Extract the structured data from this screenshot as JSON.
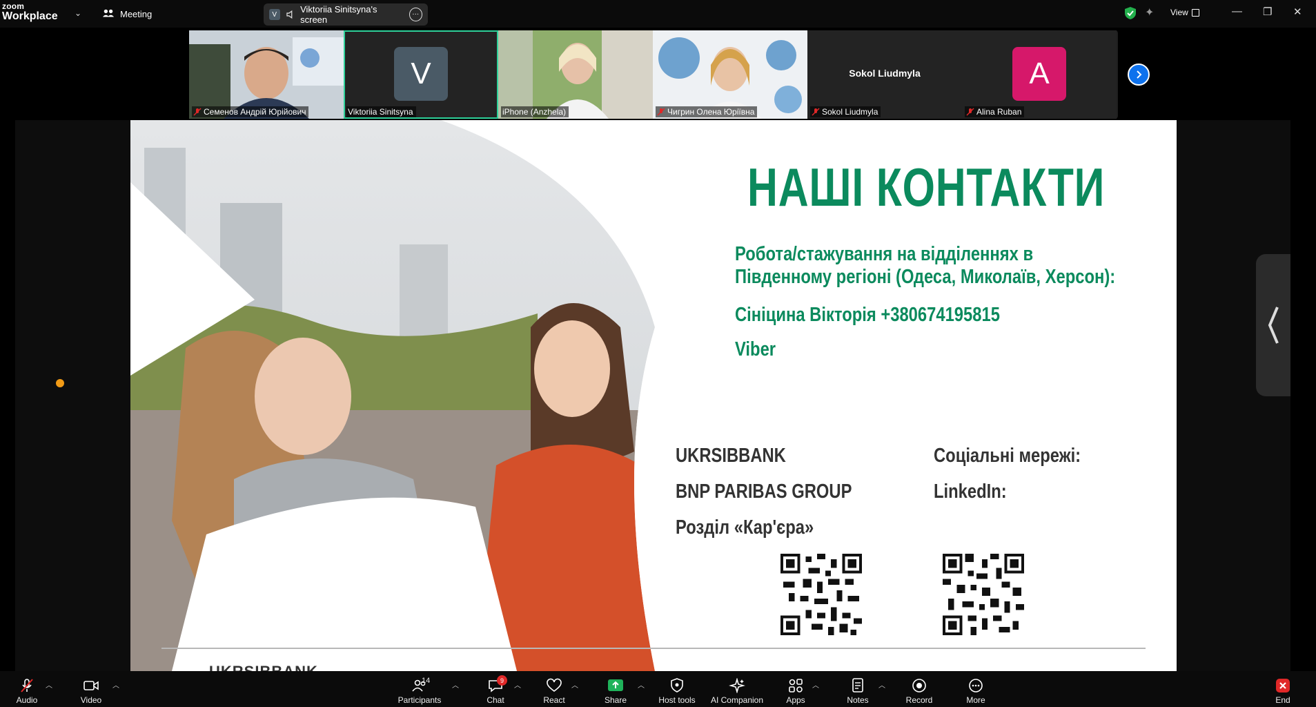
{
  "app": {
    "brand_line1": "zoom",
    "brand_line2": "Workplace",
    "meeting_label": "Meeting"
  },
  "share": {
    "badge": "V",
    "label": "Viktoriia Sinitsyna's screen"
  },
  "topbar": {
    "view_label": "View"
  },
  "participants": [
    {
      "name": "Семенов Андрій Юрійович",
      "muted": true,
      "type": "video"
    },
    {
      "name": "Viktoriia Sinitsyna",
      "muted": false,
      "type": "avatar",
      "initial": "V",
      "color": "#4a5a66",
      "active": true
    },
    {
      "name": "iPhone (Anzhela)",
      "muted": false,
      "type": "video"
    },
    {
      "name": "Чигрин Олена Юріївна",
      "muted": true,
      "type": "video"
    },
    {
      "name": "Sokol Liudmyla",
      "muted": true,
      "type": "name",
      "display": "Sokol Liudmyla"
    },
    {
      "name": "Alina Ruban",
      "muted": true,
      "type": "avatar",
      "initial": "A",
      "color": "#d6186a"
    }
  ],
  "slide": {
    "title": "НАШІ КОНТАКТИ",
    "line1": "Робота/стажування на відділеннях в",
    "line2": "Південному регіоні (Одеса, Миколаїв, Херсон):",
    "contact": "Сініцина Вікторія +380674195815",
    "viber": "Viber",
    "bank1": "UKRSIBBANK",
    "bank2": "BNP PARIBAS GROUP",
    "career": "Розділ «Кар'єра»",
    "social": "Соціальні мережі:",
    "linkedin": "LinkedIn:",
    "footer": "UKRSIBBANK"
  },
  "toolbar": {
    "audio": "Audio",
    "video": "Video",
    "participants": "Participants",
    "participants_count": "14",
    "chat": "Chat",
    "chat_badge": "9",
    "react": "React",
    "share": "Share",
    "host_tools": "Host tools",
    "ai_companion": "AI Companion",
    "apps": "Apps",
    "notes": "Notes",
    "record": "Record",
    "more": "More",
    "end": "End"
  },
  "colors": {
    "accent_green": "#0b8a5d",
    "zoom_blue": "#0e72ed",
    "end_red": "#e02828",
    "active_tile": "#2ed19a"
  }
}
